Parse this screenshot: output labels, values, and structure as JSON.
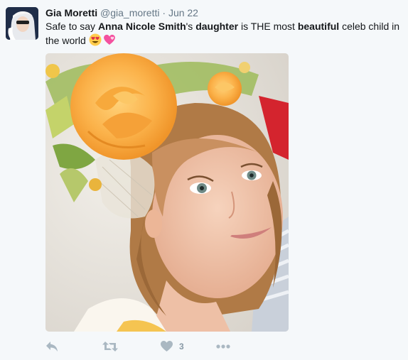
{
  "tweet": {
    "author_name": "Gia Moretti",
    "author_handle": "@gia_moretti",
    "separator": "·",
    "date": "Jun 22",
    "text_parts": [
      "Safe to say ",
      "Anna Nicole Smith",
      "'s ",
      "daughter",
      " is THE most ",
      "beautiful",
      " celeb child in the world"
    ],
    "emojis": [
      "smiling-face-with-heart-eyes",
      "revolving-hearts"
    ]
  },
  "actions": {
    "reply_icon": "reply-icon",
    "retweet_icon": "retweet-icon",
    "like_icon": "heart-icon",
    "like_count": "3",
    "more_icon": "more-dots-icon"
  },
  "colors": {
    "background": "#f5f8fa",
    "action_gray": "#aab8c2",
    "name": "#14171a",
    "meta": "#657786"
  }
}
